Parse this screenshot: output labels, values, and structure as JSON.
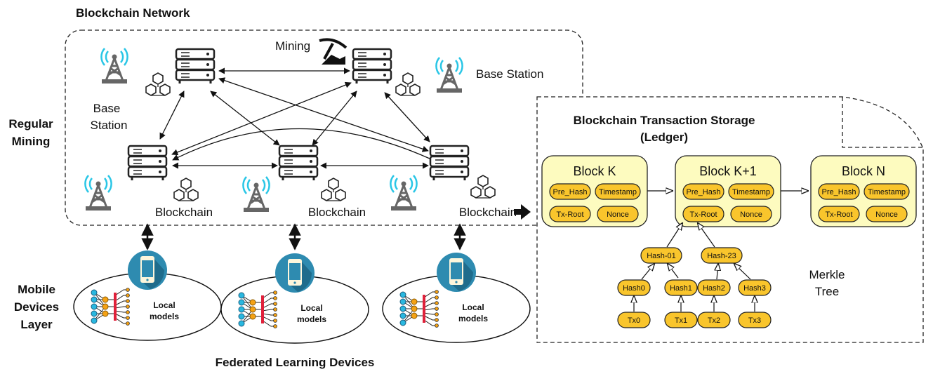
{
  "network": {
    "title": "Blockchain Network",
    "side_label": [
      "Regular",
      "Mining"
    ],
    "mining_label": "Mining",
    "base_station_right": "Base Station",
    "base_station_left": [
      "Base",
      "Station"
    ],
    "blockchain_labels": [
      "Blockchain",
      "Blockchain",
      "Blockchain"
    ]
  },
  "devices": {
    "side_label": [
      "Mobile",
      "Devices",
      "Layer"
    ],
    "caption": "Federated Learning Devices",
    "local_model_label": [
      "Local",
      "models"
    ]
  },
  "ledger": {
    "title": [
      "Blockchain Transaction Storage",
      "(Ledger)"
    ],
    "blocks": [
      {
        "title": "Block K",
        "fields": [
          "Pre_Hash",
          "Timestamp",
          "Tx-Root",
          "Nonce"
        ]
      },
      {
        "title": "Block K+1",
        "fields": [
          "Pre_Hash",
          "Timestamp",
          "Tx-Root",
          "Nonce"
        ]
      },
      {
        "title": "Block N",
        "fields": [
          "Pre_Hash",
          "Timestamp",
          "Tx-Root",
          "Nonce"
        ]
      }
    ],
    "merkle": {
      "label": [
        "Merkle",
        "Tree"
      ],
      "level1": [
        "Hash-01",
        "Hash-23"
      ],
      "level2": [
        "Hash0",
        "Hash1",
        "Hash2",
        "Hash3"
      ],
      "leaves": [
        "Tx0",
        "Tx1",
        "Tx2",
        "Tx3"
      ]
    }
  },
  "colors": {
    "block_fill": "#fdfbbf",
    "pill_fill": "#f9c52c",
    "phone_circle": "#2e8bb0",
    "tower_signal": "#29c6e6"
  }
}
